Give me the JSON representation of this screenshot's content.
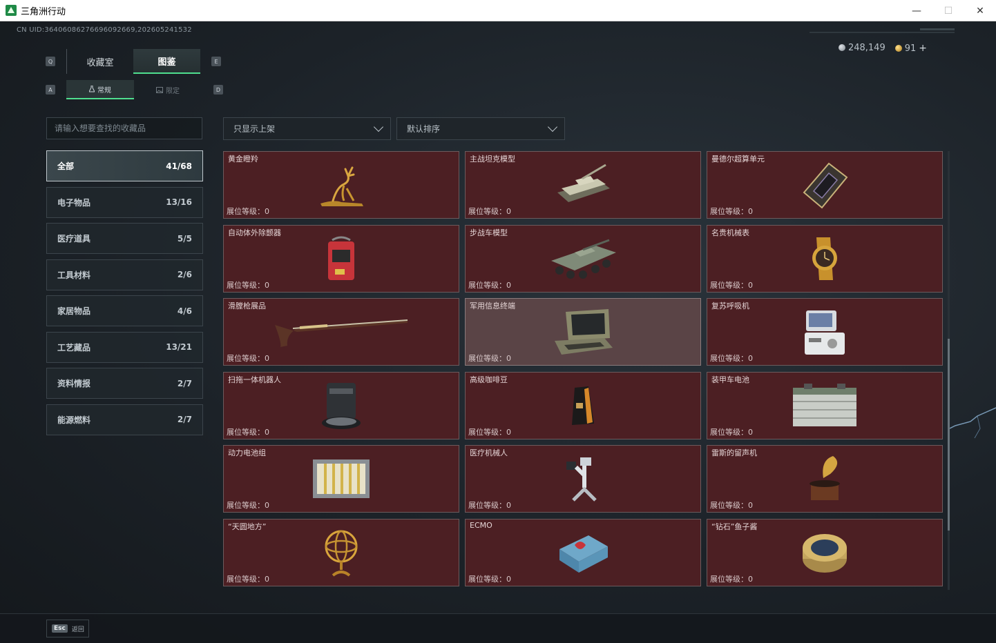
{
  "window": {
    "title": "三角洲行动",
    "minimize": "—",
    "maximize": "☐",
    "close": "✕"
  },
  "header": {
    "uid": "CN UID:36406086276696092669,202605241532",
    "currency": {
      "silver": "248,149",
      "gold": "91",
      "add": "+"
    }
  },
  "key_hints": {
    "q": "Q",
    "e": "E",
    "a": "A",
    "d": "D"
  },
  "main_tabs": [
    {
      "label": "收藏室"
    },
    {
      "label": "图鉴"
    }
  ],
  "sub_tabs": [
    {
      "label": "常规"
    },
    {
      "label": "限定"
    }
  ],
  "search": {
    "placeholder": "请输入想要查找的收藏品"
  },
  "categories": [
    {
      "label": "全部",
      "count": "41/68"
    },
    {
      "label": "电子物品",
      "count": "13/16"
    },
    {
      "label": "医疗道具",
      "count": "5/5"
    },
    {
      "label": "工具材料",
      "count": "2/6"
    },
    {
      "label": "家居物品",
      "count": "4/6"
    },
    {
      "label": "工艺藏品",
      "count": "13/21"
    },
    {
      "label": "资料情报",
      "count": "2/7"
    },
    {
      "label": "能源燃料",
      "count": "2/7"
    }
  ],
  "filters": {
    "shelf": "只显示上架",
    "sort": "默认排序"
  },
  "level_label": "展位等级：",
  "items": [
    {
      "name": "黄金瞪羚",
      "level": "0",
      "icon": "gazelle-icon"
    },
    {
      "name": "主战坦克模型",
      "level": "0",
      "icon": "tank-icon"
    },
    {
      "name": "曼德尔超算单元",
      "level": "0",
      "icon": "chip-icon"
    },
    {
      "name": "自动体外除颤器",
      "level": "0",
      "icon": "defibrillator-icon"
    },
    {
      "name": "步战车模型",
      "level": "0",
      "icon": "ifv-icon"
    },
    {
      "name": "名贵机械表",
      "level": "0",
      "icon": "watch-icon"
    },
    {
      "name": "滑膛枪展品",
      "level": "0",
      "icon": "musket-icon"
    },
    {
      "name": "军用信息终端",
      "level": "0",
      "icon": "terminal-icon"
    },
    {
      "name": "复苏呼吸机",
      "level": "0",
      "icon": "ventilator-icon"
    },
    {
      "name": "扫拖一体机器人",
      "level": "0",
      "icon": "robot-vacuum-icon"
    },
    {
      "name": "高级咖啡豆",
      "level": "0",
      "icon": "coffee-icon"
    },
    {
      "name": "装甲车电池",
      "level": "0",
      "icon": "battery-icon"
    },
    {
      "name": "动力电池组",
      "level": "0",
      "icon": "battery-pack-icon"
    },
    {
      "name": "医疗机械人",
      "level": "0",
      "icon": "medical-robot-icon"
    },
    {
      "name": "雷斯的留声机",
      "level": "0",
      "icon": "gramophone-icon"
    },
    {
      "name": "“天圆地方”",
      "level": "0",
      "icon": "armillary-icon"
    },
    {
      "name": "ECMO",
      "level": "0",
      "icon": "ecmo-icon"
    },
    {
      "name": "“钻石”鱼子酱",
      "level": "0",
      "icon": "caviar-icon"
    }
  ],
  "bottom": {
    "esc_key": "Esc",
    "back_label": "返回"
  }
}
